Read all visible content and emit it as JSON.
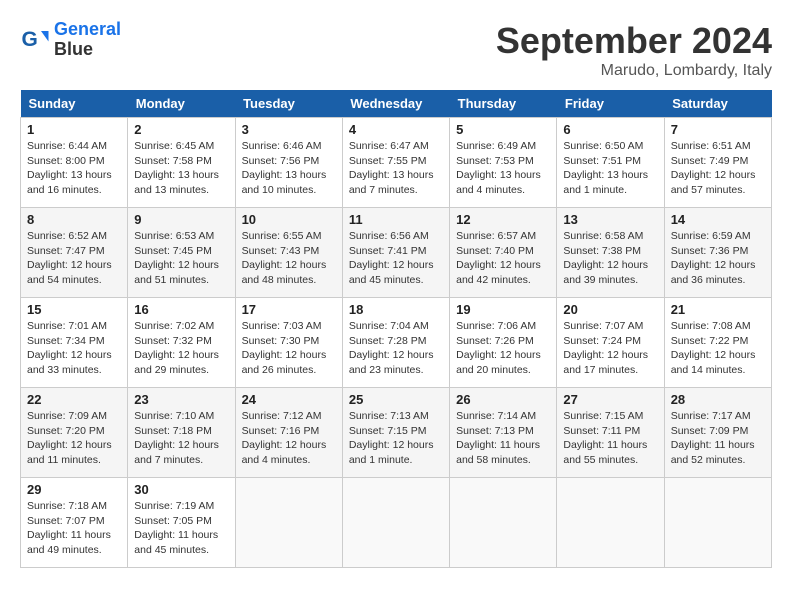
{
  "header": {
    "logo_line1": "General",
    "logo_line2": "Blue",
    "month": "September 2024",
    "location": "Marudo, Lombardy, Italy"
  },
  "weekdays": [
    "Sunday",
    "Monday",
    "Tuesday",
    "Wednesday",
    "Thursday",
    "Friday",
    "Saturday"
  ],
  "weeks": [
    [
      {
        "day": "1",
        "info": "Sunrise: 6:44 AM\nSunset: 8:00 PM\nDaylight: 13 hours\nand 16 minutes."
      },
      {
        "day": "2",
        "info": "Sunrise: 6:45 AM\nSunset: 7:58 PM\nDaylight: 13 hours\nand 13 minutes."
      },
      {
        "day": "3",
        "info": "Sunrise: 6:46 AM\nSunset: 7:56 PM\nDaylight: 13 hours\nand 10 minutes."
      },
      {
        "day": "4",
        "info": "Sunrise: 6:47 AM\nSunset: 7:55 PM\nDaylight: 13 hours\nand 7 minutes."
      },
      {
        "day": "5",
        "info": "Sunrise: 6:49 AM\nSunset: 7:53 PM\nDaylight: 13 hours\nand 4 minutes."
      },
      {
        "day": "6",
        "info": "Sunrise: 6:50 AM\nSunset: 7:51 PM\nDaylight: 13 hours\nand 1 minute."
      },
      {
        "day": "7",
        "info": "Sunrise: 6:51 AM\nSunset: 7:49 PM\nDaylight: 12 hours\nand 57 minutes."
      }
    ],
    [
      {
        "day": "8",
        "info": "Sunrise: 6:52 AM\nSunset: 7:47 PM\nDaylight: 12 hours\nand 54 minutes."
      },
      {
        "day": "9",
        "info": "Sunrise: 6:53 AM\nSunset: 7:45 PM\nDaylight: 12 hours\nand 51 minutes."
      },
      {
        "day": "10",
        "info": "Sunrise: 6:55 AM\nSunset: 7:43 PM\nDaylight: 12 hours\nand 48 minutes."
      },
      {
        "day": "11",
        "info": "Sunrise: 6:56 AM\nSunset: 7:41 PM\nDaylight: 12 hours\nand 45 minutes."
      },
      {
        "day": "12",
        "info": "Sunrise: 6:57 AM\nSunset: 7:40 PM\nDaylight: 12 hours\nand 42 minutes."
      },
      {
        "day": "13",
        "info": "Sunrise: 6:58 AM\nSunset: 7:38 PM\nDaylight: 12 hours\nand 39 minutes."
      },
      {
        "day": "14",
        "info": "Sunrise: 6:59 AM\nSunset: 7:36 PM\nDaylight: 12 hours\nand 36 minutes."
      }
    ],
    [
      {
        "day": "15",
        "info": "Sunrise: 7:01 AM\nSunset: 7:34 PM\nDaylight: 12 hours\nand 33 minutes."
      },
      {
        "day": "16",
        "info": "Sunrise: 7:02 AM\nSunset: 7:32 PM\nDaylight: 12 hours\nand 29 minutes."
      },
      {
        "day": "17",
        "info": "Sunrise: 7:03 AM\nSunset: 7:30 PM\nDaylight: 12 hours\nand 26 minutes."
      },
      {
        "day": "18",
        "info": "Sunrise: 7:04 AM\nSunset: 7:28 PM\nDaylight: 12 hours\nand 23 minutes."
      },
      {
        "day": "19",
        "info": "Sunrise: 7:06 AM\nSunset: 7:26 PM\nDaylight: 12 hours\nand 20 minutes."
      },
      {
        "day": "20",
        "info": "Sunrise: 7:07 AM\nSunset: 7:24 PM\nDaylight: 12 hours\nand 17 minutes."
      },
      {
        "day": "21",
        "info": "Sunrise: 7:08 AM\nSunset: 7:22 PM\nDaylight: 12 hours\nand 14 minutes."
      }
    ],
    [
      {
        "day": "22",
        "info": "Sunrise: 7:09 AM\nSunset: 7:20 PM\nDaylight: 12 hours\nand 11 minutes."
      },
      {
        "day": "23",
        "info": "Sunrise: 7:10 AM\nSunset: 7:18 PM\nDaylight: 12 hours\nand 7 minutes."
      },
      {
        "day": "24",
        "info": "Sunrise: 7:12 AM\nSunset: 7:16 PM\nDaylight: 12 hours\nand 4 minutes."
      },
      {
        "day": "25",
        "info": "Sunrise: 7:13 AM\nSunset: 7:15 PM\nDaylight: 12 hours\nand 1 minute."
      },
      {
        "day": "26",
        "info": "Sunrise: 7:14 AM\nSunset: 7:13 PM\nDaylight: 11 hours\nand 58 minutes."
      },
      {
        "day": "27",
        "info": "Sunrise: 7:15 AM\nSunset: 7:11 PM\nDaylight: 11 hours\nand 55 minutes."
      },
      {
        "day": "28",
        "info": "Sunrise: 7:17 AM\nSunset: 7:09 PM\nDaylight: 11 hours\nand 52 minutes."
      }
    ],
    [
      {
        "day": "29",
        "info": "Sunrise: 7:18 AM\nSunset: 7:07 PM\nDaylight: 11 hours\nand 49 minutes."
      },
      {
        "day": "30",
        "info": "Sunrise: 7:19 AM\nSunset: 7:05 PM\nDaylight: 11 hours\nand 45 minutes."
      },
      {
        "day": "",
        "info": ""
      },
      {
        "day": "",
        "info": ""
      },
      {
        "day": "",
        "info": ""
      },
      {
        "day": "",
        "info": ""
      },
      {
        "day": "",
        "info": ""
      }
    ]
  ]
}
